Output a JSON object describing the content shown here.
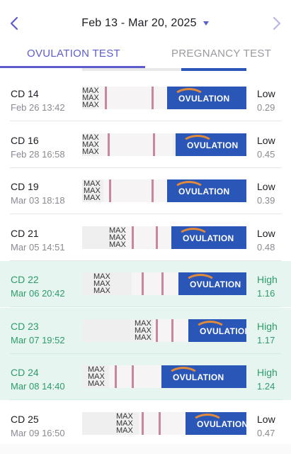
{
  "header": {
    "date_range": "Feb 13 - Mar 20, 2025",
    "prev_icon": "chevron-left-icon",
    "next_icon": "chevron-right-icon",
    "dropdown_icon": "caret-down-icon"
  },
  "tabs": [
    {
      "label": "OVULATION TEST",
      "active": true
    },
    {
      "label": "PREGNANCY TEST",
      "active": false
    }
  ],
  "colors": {
    "accent": "#5c5ccf",
    "high_bg": "#e6f5ef",
    "high_text": "#2e9b6b",
    "strip_blue": "#2a56b8"
  },
  "strip_text": {
    "max": "MAX",
    "brand": "OVULATION"
  },
  "results": [
    {
      "cd": "CD 14",
      "when": "Feb 26 13:42",
      "level": "Low",
      "value": "0.29",
      "high": false
    },
    {
      "cd": "CD 16",
      "when": "Feb 28 16:58",
      "level": "Low",
      "value": "0.45",
      "high": false
    },
    {
      "cd": "CD 19",
      "when": "Mar 03 18:18",
      "level": "Low",
      "value": "0.39",
      "high": false
    },
    {
      "cd": "CD 21",
      "when": "Mar 05 14:51",
      "level": "Low",
      "value": "0.48",
      "high": false
    },
    {
      "cd": "CD 22",
      "when": "Mar 06 20:42",
      "level": "High",
      "value": "1.16",
      "high": true
    },
    {
      "cd": "CD 23",
      "when": "Mar 07 19:52",
      "level": "High",
      "value": "1.17",
      "high": true
    },
    {
      "cd": "CD 24",
      "when": "Mar 08 14:40",
      "level": "High",
      "value": "1.24",
      "high": true
    },
    {
      "cd": "CD 25",
      "when": "Mar 09 16:50",
      "level": "Low",
      "value": "0.47",
      "high": false
    }
  ]
}
